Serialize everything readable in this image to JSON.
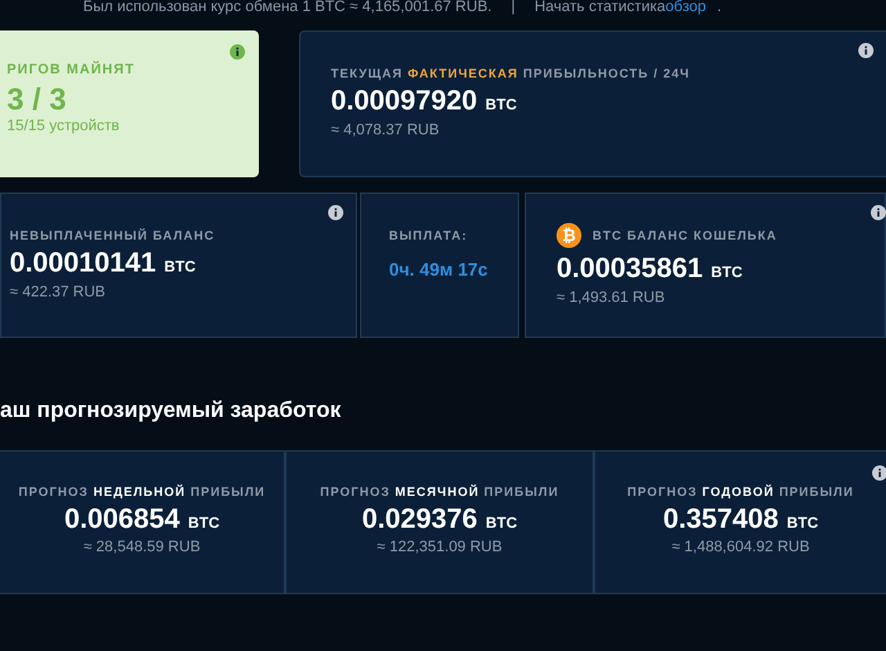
{
  "rate_note": {
    "text": "Был использован курс обмена 1 BTC ≈ 4,165,001.67 RUB.",
    "separator": "|",
    "stats_text": "Начать статистика",
    "stats_link": "обзор",
    "end": "."
  },
  "rigs": {
    "label": "РИГОВ МАЙНЯТ",
    "value": "3 / 3",
    "devices": "15/15 устройств",
    "info": true
  },
  "profitability": {
    "label": "ТЕКУЩАЯ **ФАКТИЧЕСКАЯ** ПРИБЫЛЬНОСТЬ / 24Ч",
    "amount": "0.00097920",
    "unit": "BTC",
    "fiat": "≈ 4,078.37 RUB",
    "info": true
  },
  "balances": [
    {
      "kind": "balance",
      "label": "НЕВЫПЛАЧЕННЫЙ БАЛАНС",
      "amount": "0.00010141",
      "unit": "BTC",
      "fiat": "≈ 422.37 RUB",
      "info": true
    },
    {
      "kind": "payout",
      "label": "ВЫПЛАТА:",
      "time": "0ч. 49м 17с",
      "info": false
    },
    {
      "kind": "wallet",
      "icon": "₿",
      "label": "BTC БАЛАНС КОШЕЛЬКА",
      "amount": "0.00035861",
      "unit": "BTC",
      "fiat": "≈ 1,493.61 RUB",
      "info": true
    }
  ],
  "forecast": {
    "heading": "аш прогнозируемый заработок",
    "items": [
      {
        "label": "ПРОГНОЗ **НЕДЕЛЬНОЙ** ПРИБЫЛИ",
        "amount": "0.006854",
        "unit": "BTC",
        "fiat": "≈ 28,548.59 RUB",
        "info": false
      },
      {
        "label": "ПРОГНОЗ **МЕСЯЧНОЙ** ПРИБЫЛИ",
        "amount": "0.029376",
        "unit": "BTC",
        "fiat": "≈ 122,351.09 RUB",
        "info": false
      },
      {
        "label": "ПРОГНОЗ **ГОДОВОЙ** ПРИБЫЛИ",
        "amount": "0.357408",
        "unit": "BTC",
        "fiat": "≈ 1,488,604.92 RUB",
        "info": true
      }
    ]
  }
}
